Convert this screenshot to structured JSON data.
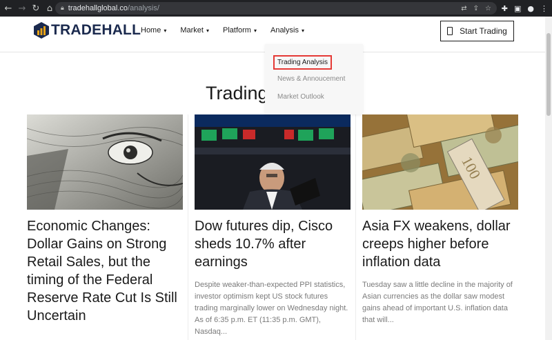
{
  "browser": {
    "url_domain": "tradehallglobal.co",
    "url_path": "/analysis/"
  },
  "site": {
    "logo_text": "TRADEHALL",
    "nav": [
      {
        "label": "Home"
      },
      {
        "label": "Market"
      },
      {
        "label": "Platform"
      },
      {
        "label": "Analysis"
      }
    ],
    "cta_label": "Start Trading"
  },
  "dropdown": {
    "items": [
      {
        "label": "Trading Analysis"
      },
      {
        "label": "News & Annoucement"
      },
      {
        "label": "Market Outlook"
      }
    ]
  },
  "page": {
    "heading": "Trading"
  },
  "cards": [
    {
      "title": "Economic Changes: Dollar Gains on Strong Retail Sales, but the timing of the Federal Reserve Rate Cut Is Still Uncertain",
      "excerpt": ""
    },
    {
      "title": "Dow futures dip, Cisco sheds 10.7% after earnings",
      "excerpt": "Despite weaker-than-expected PPI statistics, investor optimism kept US stock futures trading marginally lower on Wednesday night. As of 6:35 p.m. ET (11:35 p.m. GMT), Nasdaq..."
    },
    {
      "title": "Asia FX weakens, dollar creeps higher before inflation data",
      "excerpt": "Tuesday saw a little decline in the majority of Asian currencies as the dollar saw modest gains ahead of important U.S. inflation data that will..."
    }
  ],
  "colors": {
    "brand_navy": "#1b2a4e",
    "brand_gold": "#e8a317",
    "highlight_red": "#e53935"
  }
}
